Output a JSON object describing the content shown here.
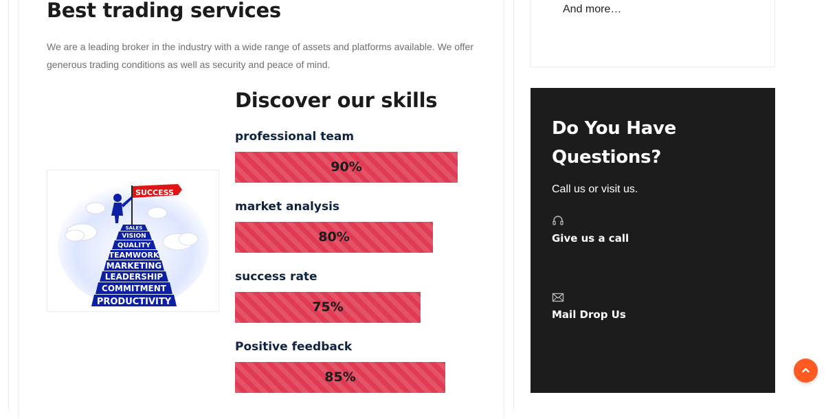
{
  "main": {
    "title": "Best trading services",
    "intro": "We are a leading broker in the industry with a wide range of assets and platforms available. We offer generous trading conditions as well as security and peace of mind.",
    "illustration": {
      "flag_text": "SUCCESS",
      "steps": [
        "SALES",
        "VISION",
        "QUALITY",
        "TEAMWORK",
        "MARKETING",
        "LEADERSHIP",
        "COMMITMENT",
        "PRODUCTIVITY"
      ]
    },
    "skills_title": "Discover our skills",
    "skills": [
      {
        "label": "professional team",
        "value": "90%",
        "percent": 90
      },
      {
        "label": "market analysis",
        "value": "80%",
        "percent": 80
      },
      {
        "label": "success rate",
        "value": "75%",
        "percent": 75
      },
      {
        "label": "Positive feedback",
        "value": "85%",
        "percent": 85
      }
    ]
  },
  "sidebar": {
    "widget": {
      "more_text": "And more…"
    },
    "contact": {
      "title": "Do You Have Questions?",
      "subtitle": "Call us or visit us.",
      "call_icon": "headphones-icon",
      "call_label": "Give us a call",
      "mail_icon": "envelope-icon",
      "mail_label": "Mail Drop Us"
    }
  },
  "scroll_top": {
    "icon": "chevron-up-icon"
  },
  "colors": {
    "accent": "#ff5a1f",
    "skill_bar": "#e03b52",
    "dark_panel": "#1c1c1c",
    "heading": "#1b1b1b",
    "skill_label": "#0e2340"
  }
}
